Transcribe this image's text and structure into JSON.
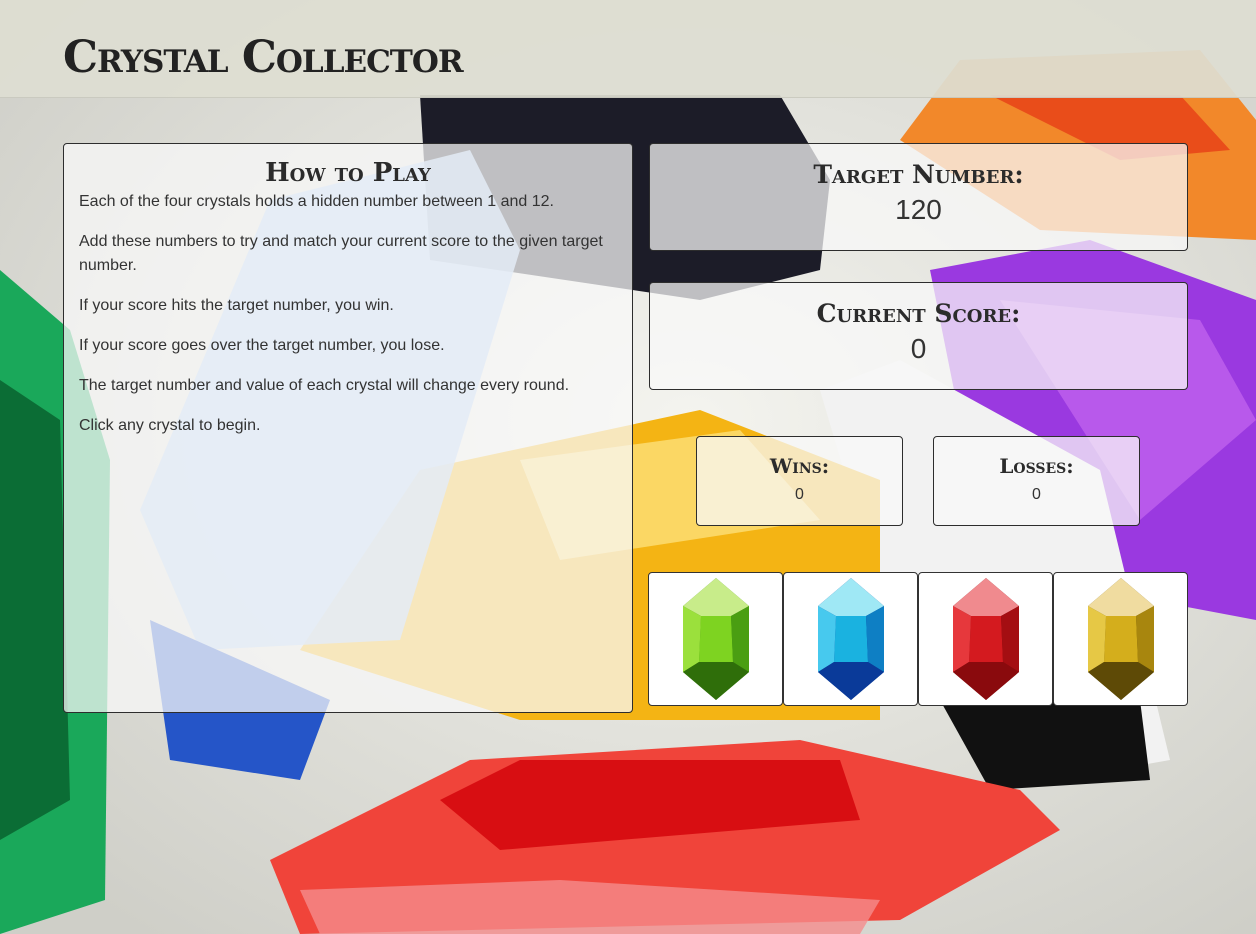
{
  "app": {
    "title": "Crystal Collector"
  },
  "instructions": {
    "heading": "How to Play",
    "paragraphs": [
      "Each of the four crystals holds a hidden number between 1 and 12.",
      "Add these numbers to try and match your current score to the given target number.",
      "If your score hits the target number, you win.",
      "If your score goes over the target number, you lose.",
      "The target number and value of each crystal will change every round.",
      "Click any crystal to begin."
    ]
  },
  "target": {
    "label": "Target Number:",
    "value": "120"
  },
  "score": {
    "label": "Current Score:",
    "value": "0"
  },
  "wins": {
    "label": "Wins:",
    "value": "0"
  },
  "losses": {
    "label": "Losses:",
    "value": "0"
  },
  "crystals": [
    {
      "icon": "green-crystal-icon",
      "color": "#5cb814"
    },
    {
      "icon": "blue-crystal-icon",
      "color": "#1e9fd8"
    },
    {
      "icon": "red-crystal-icon",
      "color": "#c8161a"
    },
    {
      "icon": "gold-crystal-icon",
      "color": "#c7a21c"
    }
  ]
}
